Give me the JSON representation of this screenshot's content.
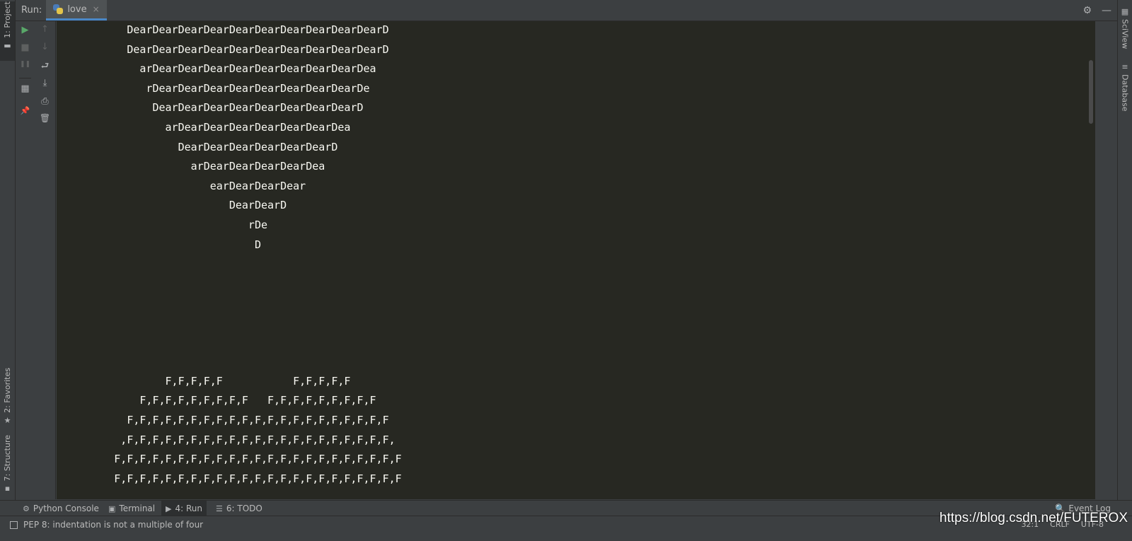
{
  "left_strip": {
    "project_tab": "1: Project",
    "favorites_tab": "2: Favorites",
    "structure_tab": "7: Structure"
  },
  "right_strip": {
    "sciview_tab": "SciView",
    "database_tab": "Database"
  },
  "run_header": {
    "label": "Run:",
    "tab_label": "love",
    "close_glyph": "×",
    "settings_glyph": "⚙",
    "minimize_glyph": "—"
  },
  "toolbar": {
    "run_glyph": "▶",
    "stop_glyph": "■",
    "pause_glyph": "❚❚",
    "layout_glyph": "▦",
    "pin_glyph": "📌",
    "up_glyph": "↑",
    "down_glyph": "↓",
    "wrap_glyph": "⮐",
    "scroll_end_glyph": "⤓",
    "print_glyph": "⎙",
    "trash_glyph": "🗑"
  },
  "console": {
    "lines": [
      "           DearDearDearDearDearDearDearDearDearDearD",
      "           DearDearDearDearDearDearDearDearDearDearD",
      "             arDearDearDearDearDearDearDearDearDea",
      "              rDearDearDearDearDearDearDearDearDe",
      "               DearDearDearDearDearDearDearDearD",
      "                 arDearDearDearDearDearDearDea",
      "                   DearDearDearDearDearDearD",
      "                     arDearDearDearDearDea",
      "                        earDearDearDear",
      "                           DearDearD",
      "                              rDe",
      "                               D",
      "",
      "",
      "",
      "",
      "",
      "",
      "                 F,F,F,F,F           F,F,F,F,F",
      "             F,F,F,F,F,F,F,F,F   F,F,F,F,F,F,F,F,F",
      "           F,F,F,F,F,F,F,F,F,F,F,F,F,F,F,F,F,F,F,F,F",
      "          ,F,F,F,F,F,F,F,F,F,F,F,F,F,F,F,F,F,F,F,F,F,",
      "         F,F,F,F,F,F,F,F,F,F,F,F,F,F,F,F,F,F,F,F,F,F,F",
      "         F,F,F,F,F,F,F,F,F,F,F,F,F,F,F,F,F,F,F,F,F,F,F"
    ]
  },
  "bottom_tabs": {
    "python_console": "Python Console",
    "terminal": "Terminal",
    "run": "4: Run",
    "todo": "6: TODO",
    "event_log": "Event Log"
  },
  "status_bar": {
    "message": "PEP 8: indentation is not a multiple of four",
    "position": "32:1",
    "line_sep": "CRLF",
    "encoding": "UTF-8",
    "watermark": "https://blog.csdn.net/FUTEROX"
  }
}
